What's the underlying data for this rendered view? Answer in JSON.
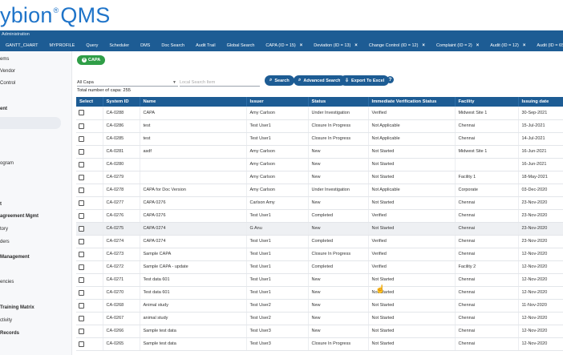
{
  "app": {
    "logo_text": "ybion",
    "logo_mark": "®",
    "logo_product": "QMS"
  },
  "topbar": {
    "admin_label": "Administration",
    "menu": [
      {
        "label": "GANTT_CHART",
        "closable": false
      },
      {
        "label": "MYPROFILE",
        "closable": false
      },
      {
        "label": "Query",
        "closable": false
      },
      {
        "label": "Scheduler",
        "closable": false
      },
      {
        "label": "DMS",
        "closable": false
      },
      {
        "label": "Doc Search",
        "closable": false
      },
      {
        "label": "Audit Trail",
        "closable": false
      },
      {
        "label": "Global Search",
        "closable": false
      },
      {
        "label": "CAPA (ID = 15)",
        "closable": true
      },
      {
        "label": "Deviation (ID = 13)",
        "closable": true
      },
      {
        "label": "Change Control (ID = 12)",
        "closable": true
      },
      {
        "label": "Complaint (ID = 2)",
        "closable": true
      },
      {
        "label": "Audit (ID = 12)",
        "closable": true
      },
      {
        "label": "Audit (ID = 65)",
        "closable": true
      }
    ]
  },
  "sidebar": {
    "items": [
      {
        "label": "ems",
        "bold": false
      },
      {
        "label": "Vendor",
        "bold": false
      },
      {
        "label": "Control",
        "bold": false
      },
      {
        "label": "ent",
        "bold": true
      },
      {
        "label": "ogram",
        "bold": false
      },
      {
        "label": "t",
        "bold": true
      },
      {
        "label": "agreement Mgmt",
        "bold": true
      },
      {
        "label": "tory",
        "bold": false
      },
      {
        "label": "ders",
        "bold": false
      },
      {
        "label": "Management",
        "bold": true
      },
      {
        "label": "encies",
        "bold": false
      },
      {
        "label": "Training Matrix",
        "bold": true
      },
      {
        "label": "ctivity",
        "bold": false
      },
      {
        "label": "Records",
        "bold": true
      }
    ]
  },
  "toolbar": {
    "new_capa_label": "CAPA",
    "filter_value": "All Capa",
    "search_placeholder": "Local Search Item",
    "search_label": "Search",
    "advanced_search_label": "Advanced Search",
    "export_label": "Export To Excel",
    "help_label": "?",
    "total_text": "Total number of capa: 255"
  },
  "table": {
    "columns": [
      "Select",
      "System ID",
      "Name",
      "Issuer",
      "Status",
      "Immediate Verification Status",
      "Facility",
      "Issuing date"
    ],
    "rows": [
      [
        "CA-0288",
        "CAPA",
        "Amy Carlson",
        "Under Investigation",
        "Verified",
        "Midwest Site 1",
        "30-Sep-2021"
      ],
      [
        "CA-0286",
        "test",
        "Test User1",
        "Closure In Progress",
        "Not Applicable",
        "Chennai",
        "15-Jul-2021"
      ],
      [
        "CA-0285",
        "test",
        "Test User1",
        "Closure In Progress",
        "Not Applicable",
        "Chennai",
        "14-Jul-2021"
      ],
      [
        "CA-0281",
        "asdf",
        "Amy Carlson",
        "New",
        "Not Started",
        "Midwest Site 1",
        "16-Jun-2021"
      ],
      [
        "CA-0280",
        "",
        "Amy Carlson",
        "New",
        "Not Started",
        "",
        "16-Jun-2021"
      ],
      [
        "CA-0279",
        "",
        "Amy Carlson",
        "New",
        "Not Started",
        "Facility 1",
        "18-May-2021"
      ],
      [
        "CA-0278",
        "CAPA for Doc Version",
        "Amy Carlson",
        "Under Investigation",
        "Not Applicable",
        "Corporate",
        "03-Dec-2020"
      ],
      [
        "CA-0277",
        "CAPA 0276",
        "Carlson Amy",
        "New",
        "Not Started",
        "Chennai",
        "23-Nov-2020"
      ],
      [
        "CA-0276",
        "CAPA 0276",
        "Test User1",
        "Completed",
        "Verified",
        "Chennai",
        "23-Nov-2020"
      ],
      [
        "CA-0275",
        "CAPA 0274",
        "G Anu",
        "New",
        "Not Started",
        "Chennai",
        "23-Nov-2020"
      ],
      [
        "CA-0274",
        "CAPA 0274",
        "Test User1",
        "Completed",
        "Verified",
        "Chennai",
        "23-Nov-2020"
      ],
      [
        "CA-0273",
        "Sample CAPA",
        "Test User1",
        "Closure In Progress",
        "Verified",
        "Chennai",
        "12-Nov-2020"
      ],
      [
        "CA-0272",
        "Sample CAPA - update",
        "Test User1",
        "Completed",
        "Verified",
        "Facility 2",
        "12-Nov-2020"
      ],
      [
        "CA-0271",
        "Test data 601",
        "Test User1",
        "New",
        "Not Started",
        "Chennai",
        "12-Nov-2020"
      ],
      [
        "CA-0270",
        "Test data 601",
        "Test User1",
        "New",
        "Not Started",
        "Chennai",
        "12-Nov-2020"
      ],
      [
        "CA-0268",
        "Animal study",
        "Test User2",
        "New",
        "Not Started",
        "Chennai",
        "11-Nov-2020"
      ],
      [
        "CA-0267",
        "animal study",
        "Test User2",
        "New",
        "Not Started",
        "Chennai",
        "12-Nov-2020"
      ],
      [
        "CA-0266",
        "Sample test data",
        "Test User3",
        "New",
        "Not Started",
        "Chennai",
        "12-Nov-2020"
      ],
      [
        "CA-0265",
        "Sample test data",
        "Test User3",
        "Closure In Progress",
        "Not Started",
        "Chennai",
        "12-Nov-2020"
      ]
    ]
  }
}
